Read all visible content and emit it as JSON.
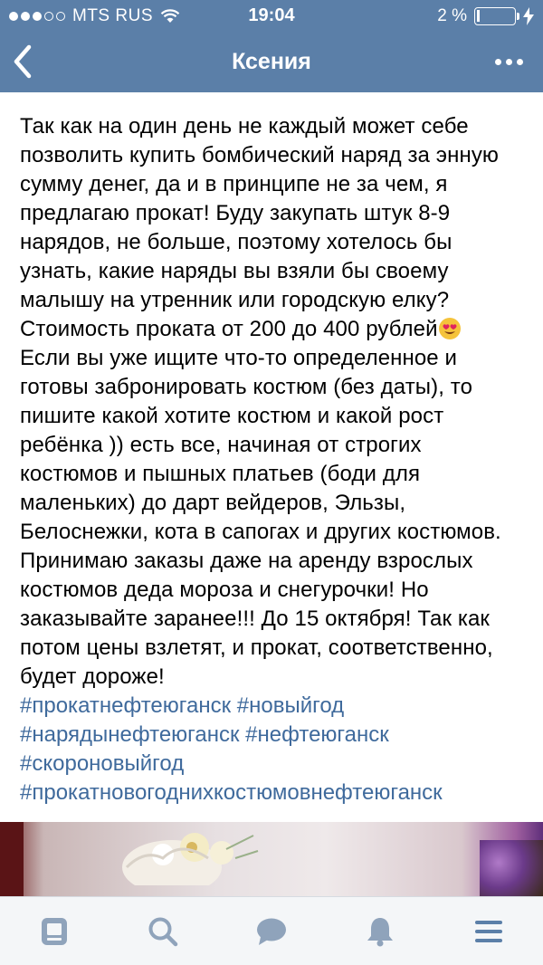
{
  "status_bar": {
    "carrier": "MTS RUS",
    "time": "19:04",
    "battery": "2 %",
    "battery_level": 0.02
  },
  "header": {
    "title": "Ксения",
    "back_icon": "chevron-left-icon",
    "more_icon": "more-horizontal-icon"
  },
  "post": {
    "text_1": "Так как на один день не каждый может себе\nпозволить купить бомбический наряд за энную\nсумму денег, да и в принципе не за чем, я\nпредлагаю прокат! Буду закупать штук 8-9\nнарядов, не больше, поэтому хотелось бы\nузнать, какие наряды вы взяли бы своему\nмалышу на утренник или городскую елку?\nСтоимость проката от 200 до 400 рублей",
    "emoji": "heart-eyes-emoji",
    "text_2": "\nЕсли вы уже ищите что-то определенное и\nготовы забронировать костюм (без даты), то\nпишите какой хотите костюм  и какой рост\nребёнка )) есть все, начиная от строгих\nкостюмов и пышных платьев (боди для\nмаленьких) до дарт вейдеров, Эльзы,\nБелоснежки, кота в сапогах и других костюмов.\nПринимаю заказы даже на аренду взрослых\nкостюмов деда мороза и снегурочки! Но\nзаказывайте заранее!!! До 15 октября! Так как\nпотом цены взлетят, и прокат, соответственно,\nбудет дороже!",
    "hashtags": [
      "#прокатнефтеюганск",
      "#новыйгод",
      "#нарядынефтеюганск",
      "#нефтеюганск",
      "#скороновыйгод",
      "#прокатновогоднихкостюмовнефтеюганск"
    ],
    "hashtag_color": "#3f6a9c"
  },
  "tabbar": {
    "items": [
      "news-icon",
      "search-icon",
      "messages-icon",
      "notifications-icon",
      "menu-icon"
    ],
    "icon_color": "#8fa3bb"
  },
  "colors": {
    "header_bg": "#5b7fa8",
    "tabbar_bg": "#f4f6f8"
  }
}
